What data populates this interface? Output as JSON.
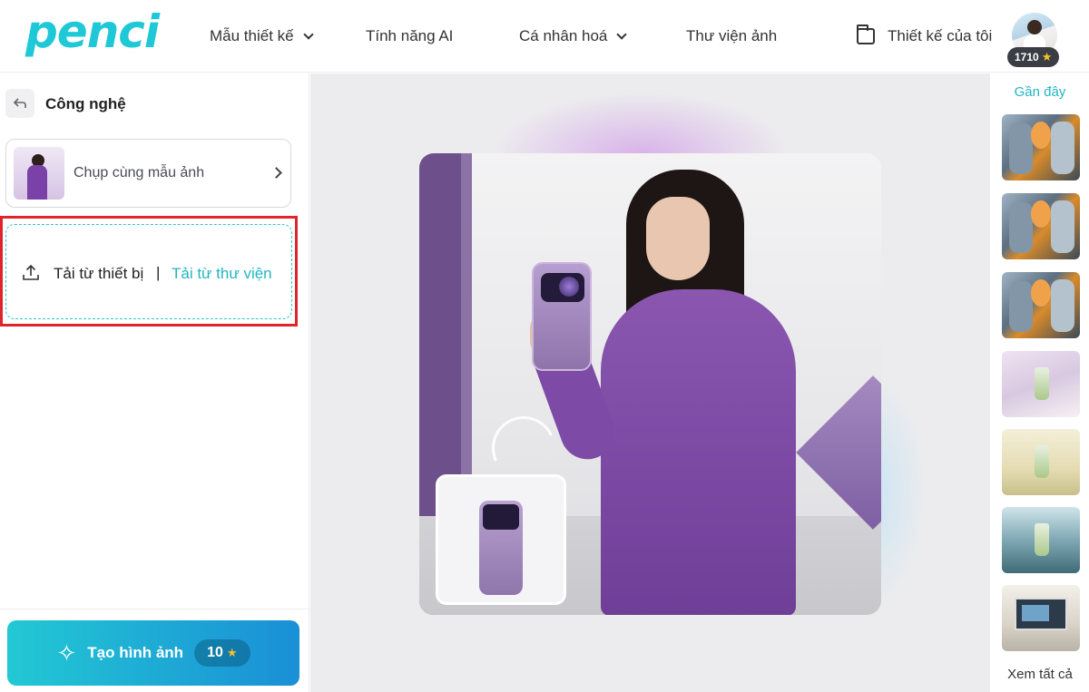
{
  "header": {
    "logo": "penci",
    "nav": [
      {
        "label": "Mẫu thiết kế",
        "dropdown": true
      },
      {
        "label": "Tính năng AI",
        "dropdown": false
      },
      {
        "label": "Cá nhân hoá",
        "dropdown": true
      },
      {
        "label": "Thư viện ảnh",
        "dropdown": false
      }
    ],
    "my_designs": "Thiết kế của tôi",
    "credits": "1710"
  },
  "left": {
    "category": "Công nghệ",
    "template_label": "Chụp cùng mẫu ảnh",
    "upload_device": "Tải từ thiết bị",
    "upload_separator": "|",
    "upload_library": "Tải từ thư viện",
    "generate_label": "Tạo hình ảnh",
    "generate_cost": "10"
  },
  "right": {
    "recent_title": "Gần đây",
    "thumbnails": [
      "robot-drink",
      "robot-drink",
      "robot-drink",
      "matcha-glass-pink",
      "matcha-glass-cream",
      "matcha-glass-sea",
      "laptop-scene"
    ],
    "see_all": "Xem tất cả"
  },
  "colors": {
    "accent": "#22b6c1",
    "gradient_start": "#22c8d4",
    "gradient_end": "#1a8fd6",
    "highlight_frame": "#e0242b",
    "dress": "#7d4aa6"
  }
}
